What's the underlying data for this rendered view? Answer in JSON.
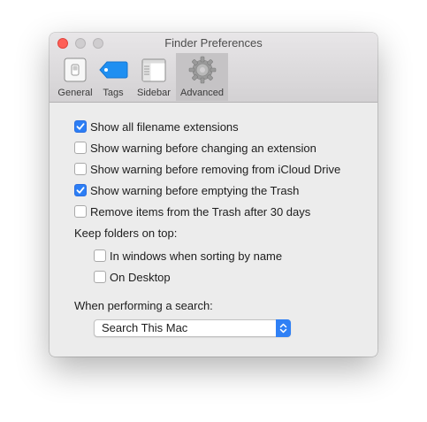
{
  "window": {
    "title": "Finder Preferences"
  },
  "tabs": [
    {
      "label": "General",
      "icon": "general-switch-icon",
      "selected": false
    },
    {
      "label": "Tags",
      "icon": "tag-icon",
      "selected": false
    },
    {
      "label": "Sidebar",
      "icon": "sidebar-icon",
      "selected": false
    },
    {
      "label": "Advanced",
      "icon": "gear-icon",
      "selected": true
    }
  ],
  "options": [
    {
      "label": "Show all filename extensions",
      "checked": true
    },
    {
      "label": "Show warning before changing an extension",
      "checked": false
    },
    {
      "label": "Show warning before removing from iCloud Drive",
      "checked": false
    },
    {
      "label": "Show warning before emptying the Trash",
      "checked": true
    },
    {
      "label": "Remove items from the Trash after 30 days",
      "checked": false
    }
  ],
  "keep_folders": {
    "heading": "Keep folders on top:",
    "options": [
      {
        "label": "In windows when sorting by name",
        "checked": false
      },
      {
        "label": "On Desktop",
        "checked": false
      }
    ]
  },
  "search": {
    "heading": "When performing a search:",
    "selected": "Search This Mac"
  },
  "colors": {
    "accent": "#2c7ef5",
    "close": "#fe5f57"
  }
}
